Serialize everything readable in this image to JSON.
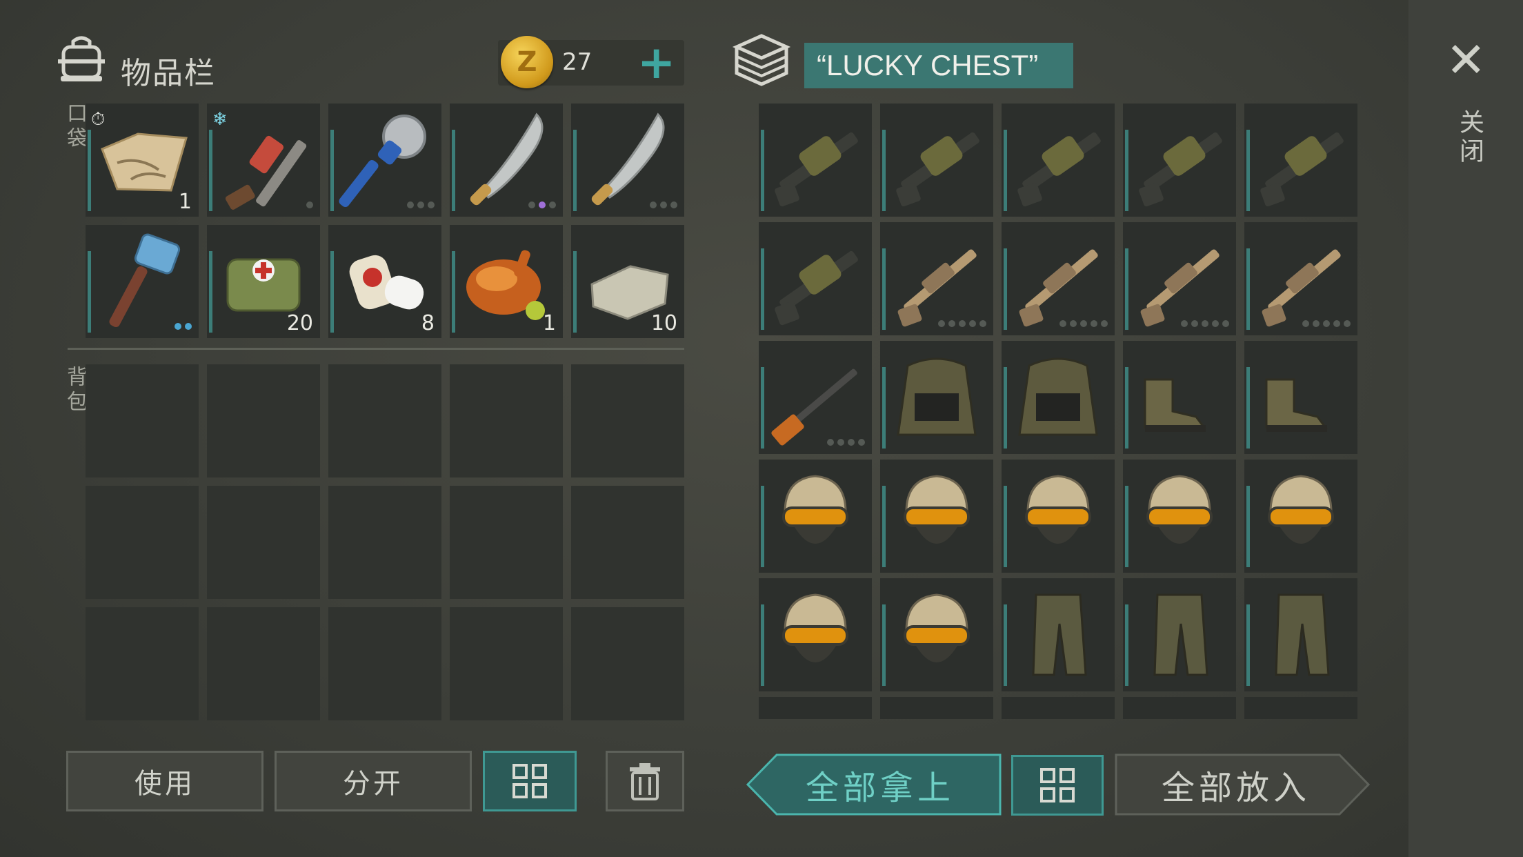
{
  "inventory": {
    "title": "物品栏",
    "coins": "27",
    "coin_letter": "Z",
    "pocket_label": "口袋",
    "backpack_label": "背包",
    "pocket_slots": [
      {
        "icon": "map-icon",
        "count": "1",
        "corner": "timer-icon"
      },
      {
        "icon": "shotgun-icon",
        "count": "",
        "corner": "frost-icon",
        "dots": 1
      },
      {
        "icon": "saw-mace-icon",
        "count": "",
        "dots": 3
      },
      {
        "icon": "machete-icon",
        "count": "",
        "dots": 3
      },
      {
        "icon": "machete-icon",
        "count": "",
        "dots": 3
      },
      {
        "icon": "sledgehammer-icon",
        "count": "",
        "dots": 2
      },
      {
        "icon": "medkit-bag-icon",
        "count": "20"
      },
      {
        "icon": "bandage-icon",
        "count": "8"
      },
      {
        "icon": "roast-chicken-icon",
        "count": "1"
      },
      {
        "icon": "stone-block-icon",
        "count": "10"
      }
    ],
    "backpack_slot_count": 15
  },
  "chest": {
    "title": "“LUCKY CHEST”",
    "slots": [
      "grenade-launcher-icon",
      "grenade-launcher-icon",
      "grenade-launcher-icon",
      "grenade-launcher-icon",
      "grenade-launcher-icon",
      "grenade-launcher-icon",
      "assault-rifle-icon",
      "assault-rifle-icon",
      "assault-rifle-icon",
      "assault-rifle-icon",
      "sniper-rifle-icon",
      "tactical-vest-icon",
      "tactical-vest-icon",
      "combat-boots-icon",
      "combat-boots-icon",
      "tactical-helmet-icon",
      "tactical-helmet-icon",
      "tactical-helmet-icon",
      "tactical-helmet-icon",
      "tactical-helmet-icon",
      "tactical-helmet-icon",
      "tactical-helmet-icon",
      "camo-pants-icon",
      "camo-pants-icon",
      "camo-pants-icon"
    ]
  },
  "close_label": "关闭",
  "buttons": {
    "use": "使用",
    "split": "分开",
    "take_all": "全部拿上",
    "put_all": "全部放入"
  },
  "colors": {
    "accent_teal": "#3f9993",
    "coin_gold": "#e0aa2a",
    "chest_title_bg": "#3b7772"
  }
}
